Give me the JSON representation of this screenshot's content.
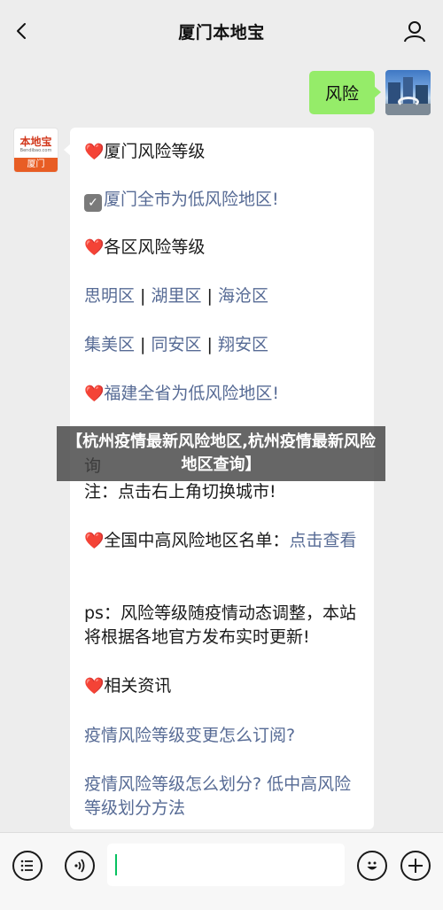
{
  "header": {
    "title": "厦门本地宝",
    "back_icon": "chevron-left-icon",
    "profile_icon": "person-icon"
  },
  "my_message": {
    "text": "风险"
  },
  "bot": {
    "avatar": {
      "logo_text": "本地宝",
      "sub_text": "Bendibao.com",
      "city": "厦门"
    },
    "lines": [
      {
        "prefix": "❤️",
        "text": "厦门风险等级"
      },
      {
        "prefix": "☑",
        "text": "厦门全市为低风险地区!"
      },
      {
        "prefix": "❤️",
        "text": "各区风险等级"
      },
      {
        "links": [
          "思明区",
          "湖里区",
          "海沧区"
        ]
      },
      {
        "links": [
          "集美区",
          "同安区",
          "翔安区"
        ]
      },
      {
        "prefix": "❤️",
        "text": "福建全省为低风险地区!"
      },
      {
        "text": "注：点击右上角切换城市!"
      },
      {
        "prefix": "❤️",
        "text": "全国中高风险地区名单：",
        "link": "点击查看"
      },
      {
        "text": "ps：风险等级随疫情动态调整，本站将根据各地官方发布实时更新!"
      },
      {
        "prefix": "❤️",
        "text": "相关资讯"
      },
      {
        "link": "疫情风险等级变更怎么订阅?"
      },
      {
        "link": "疫情风险等级怎么划分? 低中高风险等级划分方法"
      }
    ],
    "partial_line": "询"
  },
  "overlay": {
    "text": "【杭州疫情最新风险地区,杭州疫情最新风险地区查询】"
  },
  "bottom_bar": {
    "icons": [
      "menu-icon",
      "voice-icon",
      "emoji-icon",
      "plus-icon"
    ]
  },
  "colors": {
    "bubble_green": "#95ec69",
    "link": "#576b95",
    "background": "#ededed"
  }
}
